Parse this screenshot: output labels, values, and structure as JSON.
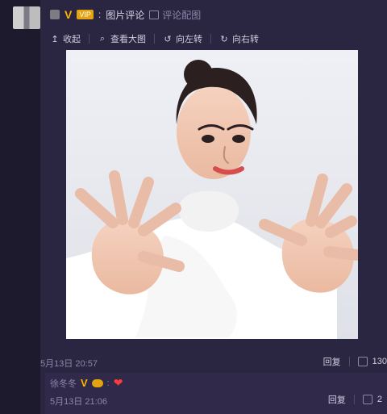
{
  "header": {
    "separator": ":",
    "link_image_comments": "图片评论",
    "link_comment_on_image": "评论配图",
    "vip_tag": "VIP"
  },
  "toolbar": {
    "collapse": "收起",
    "view_large": "查看大图",
    "rotate_left": "向左转",
    "rotate_right": "向右转"
  },
  "comment": {
    "time": "5月13日 20:57",
    "reply": "回复",
    "likes": "130"
  },
  "subcomment": {
    "username": "徐冬冬",
    "time": "5月13日 21:06",
    "reply": "回复",
    "likes": "2"
  },
  "colors": {
    "background": "#1e1a2d",
    "panel": "#2a2540",
    "accent": "#ffb400",
    "muted": "#8d86aa"
  }
}
